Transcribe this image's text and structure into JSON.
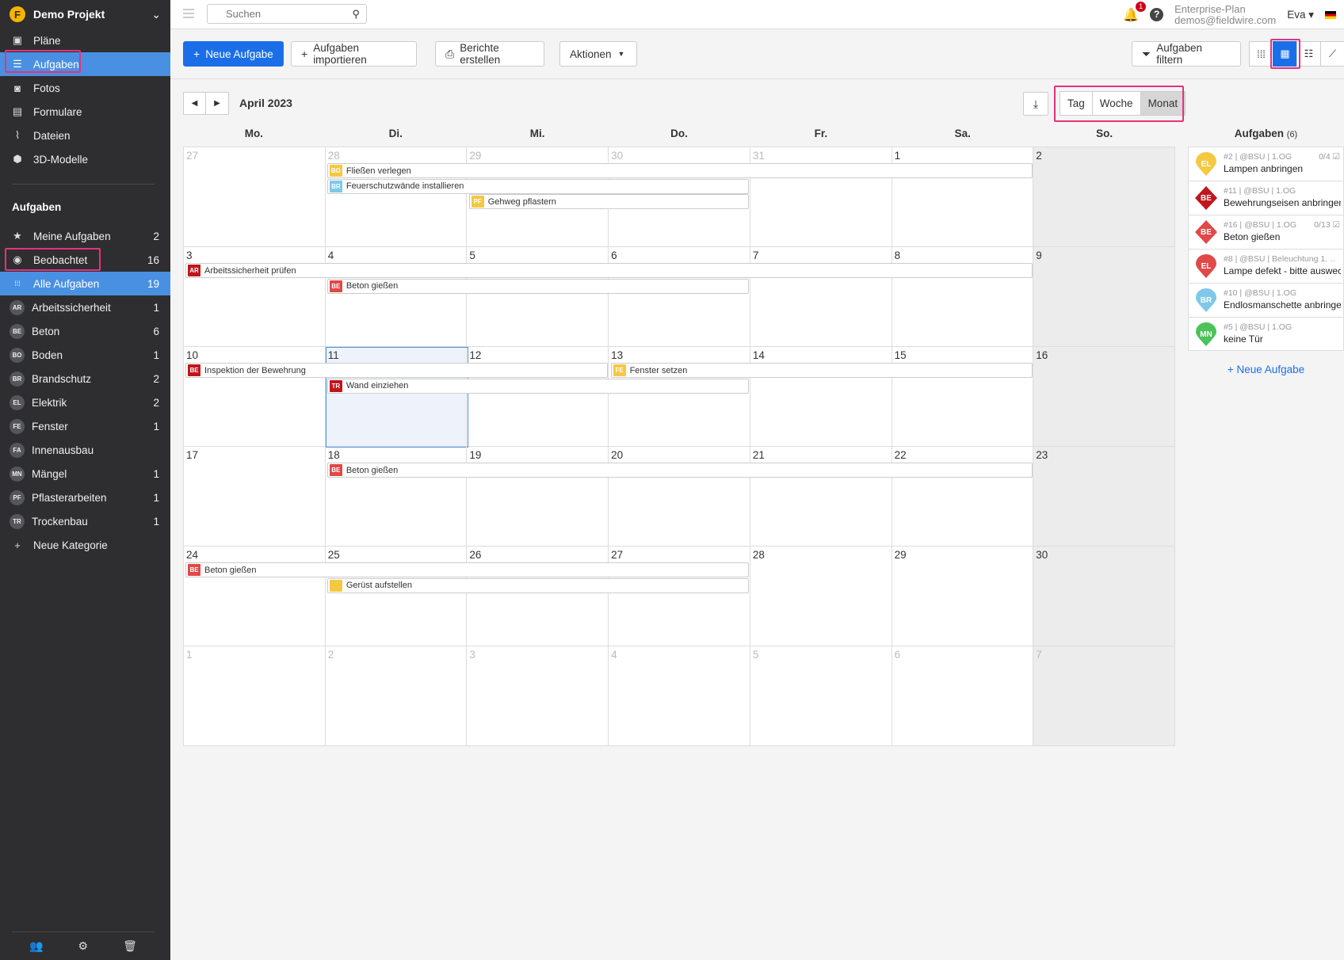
{
  "project": {
    "name": "Demo Projekt",
    "logo_letter": "F"
  },
  "nav": [
    {
      "label": "Pläne",
      "icon": "plans-icon",
      "glyph": "▣"
    },
    {
      "label": "Aufgaben",
      "icon": "list-icon",
      "glyph": "☰"
    },
    {
      "label": "Fotos",
      "icon": "camera-icon",
      "glyph": "◙"
    },
    {
      "label": "Formulare",
      "icon": "clipboard-icon",
      "glyph": "▤"
    },
    {
      "label": "Dateien",
      "icon": "paperclip-icon",
      "glyph": "⌇"
    },
    {
      "label": "3D-Modelle",
      "icon": "cube-icon",
      "glyph": "⬢"
    }
  ],
  "tasks_section": {
    "title": "Aufgaben",
    "items": [
      {
        "label": "Meine Aufgaben",
        "count": "2",
        "glyph": "★"
      },
      {
        "label": "Beobachtet",
        "count": "16",
        "glyph": "◉"
      },
      {
        "label": "Alle Aufgaben",
        "count": "19",
        "glyph": "⁞⁞⁞"
      }
    ],
    "categories": [
      {
        "code": "AR",
        "label": "Arbeitssicherheit",
        "count": "1"
      },
      {
        "code": "BE",
        "label": "Beton",
        "count": "6"
      },
      {
        "code": "BO",
        "label": "Boden",
        "count": "1"
      },
      {
        "code": "BR",
        "label": "Brandschutz",
        "count": "2"
      },
      {
        "code": "EL",
        "label": "Elektrik",
        "count": "2"
      },
      {
        "code": "FE",
        "label": "Fenster",
        "count": "1"
      },
      {
        "code": "FA",
        "label": "Innenausbau",
        "count": ""
      },
      {
        "code": "MN",
        "label": "Mängel",
        "count": "1"
      },
      {
        "code": "PF",
        "label": "Pflasterarbeiten",
        "count": "1"
      },
      {
        "code": "TR",
        "label": "Trockenbau",
        "count": "1"
      }
    ],
    "new_category": "Neue Kategorie"
  },
  "topbar": {
    "search_placeholder": "Suchen",
    "notifications": "1",
    "plan_name": "Enterprise-Plan",
    "email": "demos@fieldwire.com",
    "user": "Eva ▾"
  },
  "toolbar": {
    "new_task": "Neue Aufgabe",
    "import": "Aufgaben importieren",
    "reports": "Berichte erstellen",
    "actions": "Aktionen",
    "filter": "Aufgaben filtern"
  },
  "calendar": {
    "month": "April 2023",
    "view_tabs": [
      "Tag",
      "Woche",
      "Monat"
    ],
    "active_view": "Monat",
    "weekdays": [
      "Mo.",
      "Di.",
      "Mi.",
      "Do.",
      "Fr.",
      "Sa.",
      "So."
    ],
    "weeks": [
      [
        {
          "d": "27",
          "o": true
        },
        {
          "d": "28",
          "o": true
        },
        {
          "d": "29",
          "o": true
        },
        {
          "d": "30",
          "o": true
        },
        {
          "d": "31",
          "o": true
        },
        {
          "d": "1"
        },
        {
          "d": "2"
        }
      ],
      [
        {
          "d": "3"
        },
        {
          "d": "4"
        },
        {
          "d": "5"
        },
        {
          "d": "6"
        },
        {
          "d": "7"
        },
        {
          "d": "8"
        },
        {
          "d": "9"
        }
      ],
      [
        {
          "d": "10"
        },
        {
          "d": "11",
          "today": true
        },
        {
          "d": "12"
        },
        {
          "d": "13"
        },
        {
          "d": "14"
        },
        {
          "d": "15"
        },
        {
          "d": "16"
        }
      ],
      [
        {
          "d": "17"
        },
        {
          "d": "18"
        },
        {
          "d": "19"
        },
        {
          "d": "20"
        },
        {
          "d": "21"
        },
        {
          "d": "22"
        },
        {
          "d": "23"
        }
      ],
      [
        {
          "d": "24"
        },
        {
          "d": "25"
        },
        {
          "d": "26"
        },
        {
          "d": "27"
        },
        {
          "d": "28"
        },
        {
          "d": "29"
        },
        {
          "d": "30"
        }
      ],
      [
        {
          "d": "1",
          "o": true
        },
        {
          "d": "2",
          "o": true
        },
        {
          "d": "3",
          "o": true
        },
        {
          "d": "4",
          "o": true
        },
        {
          "d": "5",
          "o": true
        },
        {
          "d": "6",
          "o": true
        },
        {
          "d": "7",
          "o": true
        }
      ]
    ],
    "events": [
      {
        "week": 0,
        "start": 1,
        "end": 5,
        "row": 0,
        "code": "BO",
        "color": "#f5c842",
        "title": "Fließen verlegen"
      },
      {
        "week": 0,
        "start": 1,
        "end": 3,
        "row": 1,
        "code": "BR",
        "color": "#7ec8ea",
        "title": "Feuerschutzwände installieren"
      },
      {
        "week": 0,
        "start": 2,
        "end": 3,
        "row": 2,
        "code": "PF",
        "color": "#f5c842",
        "title": "Gehweg pflastern"
      },
      {
        "week": 1,
        "start": 0,
        "end": 5,
        "row": 0,
        "code": "AR",
        "color": "#c0151b",
        "title": "Arbeitssicherheit prüfen"
      },
      {
        "week": 1,
        "start": 1,
        "end": 3,
        "row": 1,
        "code": "BE",
        "color": "#e14848",
        "title": "Beton gießen"
      },
      {
        "week": 2,
        "start": 0,
        "end": 2,
        "row": 0,
        "code": "BE",
        "color": "#c0151b",
        "title": "Inspektion der Bewehrung"
      },
      {
        "week": 2,
        "start": 3,
        "end": 5,
        "row": 0,
        "code": "FE",
        "color": "#f5c842",
        "title": "Fenster setzen"
      },
      {
        "week": 2,
        "start": 1,
        "end": 3,
        "row": 1,
        "code": "TR",
        "color": "#c0151b",
        "title": "Wand einziehen"
      },
      {
        "week": 3,
        "start": 1,
        "end": 5,
        "row": 0,
        "code": "BE",
        "color": "#e14848",
        "title": "Beton gießen"
      },
      {
        "week": 4,
        "start": 0,
        "end": 3,
        "row": 0,
        "code": "BE",
        "color": "#e14848",
        "title": "Beton gießen"
      },
      {
        "week": 4,
        "start": 1,
        "end": 3,
        "row": 1,
        "code": "",
        "color": "#f5c842",
        "title": "Gerüst aufstellen"
      }
    ]
  },
  "task_panel": {
    "title": "Aufgaben",
    "count": "(6)",
    "tasks": [
      {
        "code": "EL",
        "shape": "pin",
        "color": "#f5c842",
        "meta": "#2 | @BSU | 1.OG",
        "check": "0/4 ☑",
        "title": "Lampen anbringen"
      },
      {
        "code": "BE",
        "shape": "diamond",
        "color": "#c0151b",
        "meta": "#11 | @BSU | 1.OG",
        "check": "",
        "title": "Bewehrungseisen anbringen"
      },
      {
        "code": "BE",
        "shape": "diamond",
        "color": "#e14848",
        "meta": "#16 | @BSU | 1.OG",
        "check": "0/13 ☑",
        "title": "Beton gießen"
      },
      {
        "code": "EL",
        "shape": "pin",
        "color": "#e14848",
        "meta": "#8 | @BSU | Beleuchtung 1. …",
        "check": "",
        "title": "Lampe defekt - bitte auswechseln"
      },
      {
        "code": "BR",
        "shape": "pin",
        "color": "#7ec8ea",
        "meta": "#10 | @BSU | 1.OG",
        "check": "",
        "title": "Endlosmanschette anbringen"
      },
      {
        "code": "MN",
        "shape": "pin",
        "color": "#4cc25a",
        "meta": "#5 | @BSU | 1.OG",
        "check": "",
        "title": "keine Tür"
      }
    ],
    "new_task": "+ Neue Aufgabe"
  }
}
